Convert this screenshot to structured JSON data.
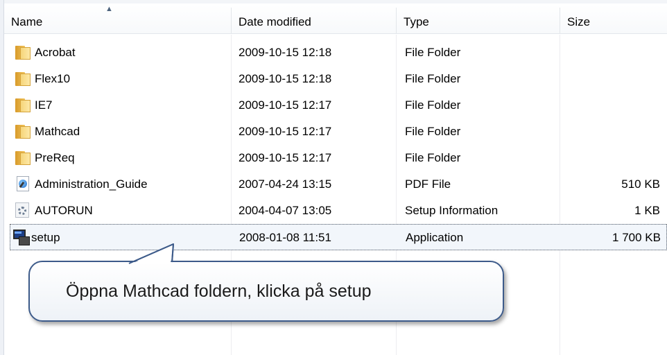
{
  "columns": {
    "name": "Name",
    "date_modified": "Date modified",
    "type": "Type",
    "size": "Size",
    "sort_indicator": "ascending"
  },
  "files": [
    {
      "name": "Acrobat",
      "date": "2009-10-15 12:18",
      "type": "File Folder",
      "size": "",
      "icon": "folder-icon"
    },
    {
      "name": "Flex10",
      "date": "2009-10-15 12:18",
      "type": "File Folder",
      "size": "",
      "icon": "folder-icon"
    },
    {
      "name": "IE7",
      "date": "2009-10-15 12:17",
      "type": "File Folder",
      "size": "",
      "icon": "folder-icon"
    },
    {
      "name": "Mathcad",
      "date": "2009-10-15 12:17",
      "type": "File Folder",
      "size": "",
      "icon": "folder-icon"
    },
    {
      "name": "PreReq",
      "date": "2009-10-15 12:17",
      "type": "File Folder",
      "size": "",
      "icon": "folder-icon"
    },
    {
      "name": "Administration_Guide",
      "date": "2007-04-24 13:15",
      "type": "PDF File",
      "size": "510 KB",
      "icon": "pdf-file-icon"
    },
    {
      "name": "AUTORUN",
      "date": "2004-04-07 13:05",
      "type": "Setup Information",
      "size": "1 KB",
      "icon": "setup-information-icon"
    },
    {
      "name": "setup",
      "date": "2008-01-08 11:51",
      "type": "Application",
      "size": "1 700 KB",
      "icon": "application-icon",
      "selected": true
    }
  ],
  "callout": {
    "text": "Öppna Mathcad foldern, klicka på setup"
  },
  "colors": {
    "callout_border": "#3d5b8a",
    "selection_background": "#f2f6fb",
    "folder": "#f2c45a"
  }
}
